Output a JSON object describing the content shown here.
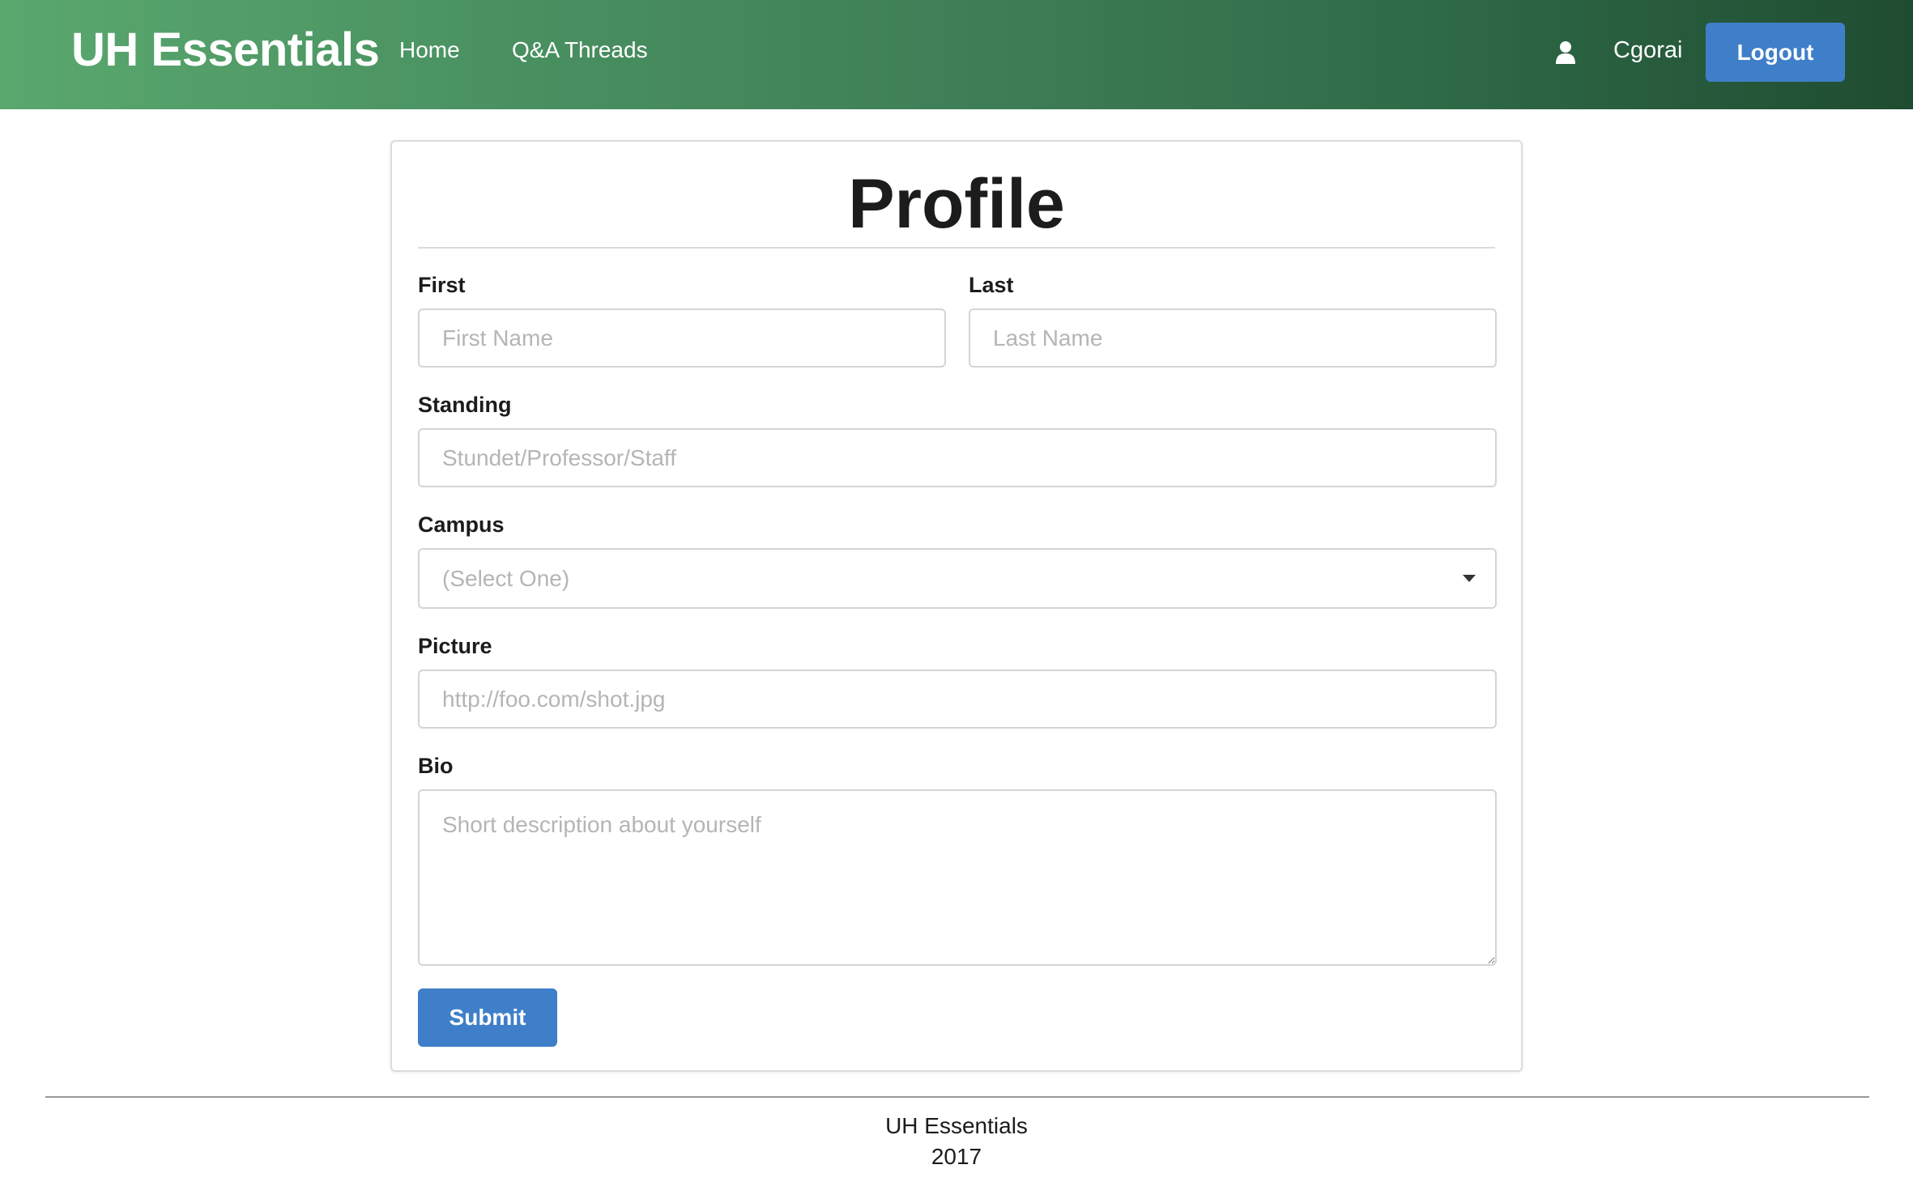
{
  "navbar": {
    "brand": "UH Essentials",
    "links": [
      {
        "label": "Home"
      },
      {
        "label": "Q&A Threads"
      }
    ],
    "user_icon": "user-icon",
    "username": "Cgorai",
    "logout_label": "Logout",
    "colors": {
      "gradient_start": "#5aa86e",
      "gradient_end": "#1f4c31",
      "button": "#3f7fc9"
    }
  },
  "form": {
    "title": "Profile",
    "first": {
      "label": "First",
      "placeholder": "First Name",
      "value": ""
    },
    "last": {
      "label": "Last",
      "placeholder": "Last Name",
      "value": ""
    },
    "standing": {
      "label": "Standing",
      "placeholder": "Stundet/Professor/Staff",
      "value": ""
    },
    "campus": {
      "label": "Campus",
      "selected": "(Select One)",
      "icon": "dropdown-caret-icon"
    },
    "picture": {
      "label": "Picture",
      "placeholder": "http://foo.com/shot.jpg",
      "value": ""
    },
    "bio": {
      "label": "Bio",
      "placeholder": "Short description about yourself",
      "value": ""
    },
    "submit_label": "Submit"
  },
  "footer": {
    "line1": "UH Essentials",
    "line2": "2017"
  }
}
